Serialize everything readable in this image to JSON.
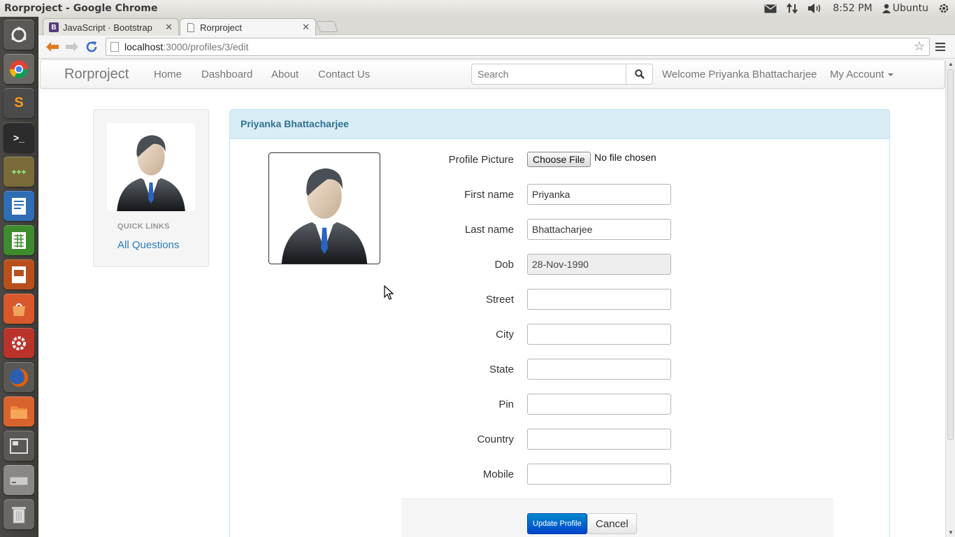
{
  "os_panel": {
    "window_title": "Rorproject - Google Chrome",
    "time": "8:52 PM",
    "user": "Ubuntu",
    "icons": [
      "mail-icon",
      "network-icon",
      "volume-icon",
      "user-icon",
      "gear-icon"
    ]
  },
  "launcher": {
    "items": [
      "dash-home",
      "chromium",
      "sublime-text",
      "terminal",
      "calc-app",
      "libreoffice-writer",
      "libreoffice-calc",
      "libreoffice-impress",
      "software-center",
      "system-settings",
      "firefox",
      "files",
      "workspace-switcher",
      "disk",
      "trash"
    ]
  },
  "browser": {
    "tabs": [
      {
        "title": "JavaScript · Bootstrap",
        "favicon": "B",
        "active": false
      },
      {
        "title": "Rorproject",
        "favicon": "",
        "active": true
      }
    ],
    "url_host": "localhost",
    "url_path": ":3000/profiles/3/edit"
  },
  "navbar": {
    "brand": "Rorproject",
    "links": [
      "Home",
      "Dashboard",
      "About",
      "Contact Us"
    ],
    "search_placeholder": "Search",
    "welcome": "Welcome Priyanka Bhattacharjee",
    "account": "My Account"
  },
  "sidebar": {
    "quick_links_heading": "QUICK LINKS",
    "link": "All Questions"
  },
  "panel": {
    "heading": "Priyanka Bhattacharjee"
  },
  "form": {
    "profile_picture_label": "Profile Picture",
    "choose_file_label": "Choose File",
    "no_file_text": "No file chosen",
    "fields": [
      {
        "label": "First name",
        "value": "Priyanka"
      },
      {
        "label": "Last name",
        "value": "Bhattacharjee"
      },
      {
        "label": "Dob",
        "value": "28-Nov-1990"
      },
      {
        "label": "Street",
        "value": ""
      },
      {
        "label": "City",
        "value": ""
      },
      {
        "label": "State",
        "value": ""
      },
      {
        "label": "Pin",
        "value": ""
      },
      {
        "label": "Country",
        "value": ""
      },
      {
        "label": "Mobile",
        "value": ""
      }
    ],
    "submit_label": "Update Profile",
    "cancel_label": "Cancel"
  },
  "colors": {
    "panel_heading_bg": "#d9edf7",
    "panel_heading_text": "#31708f",
    "link": "#2a7bbf",
    "primary_button": "#0055cc"
  }
}
